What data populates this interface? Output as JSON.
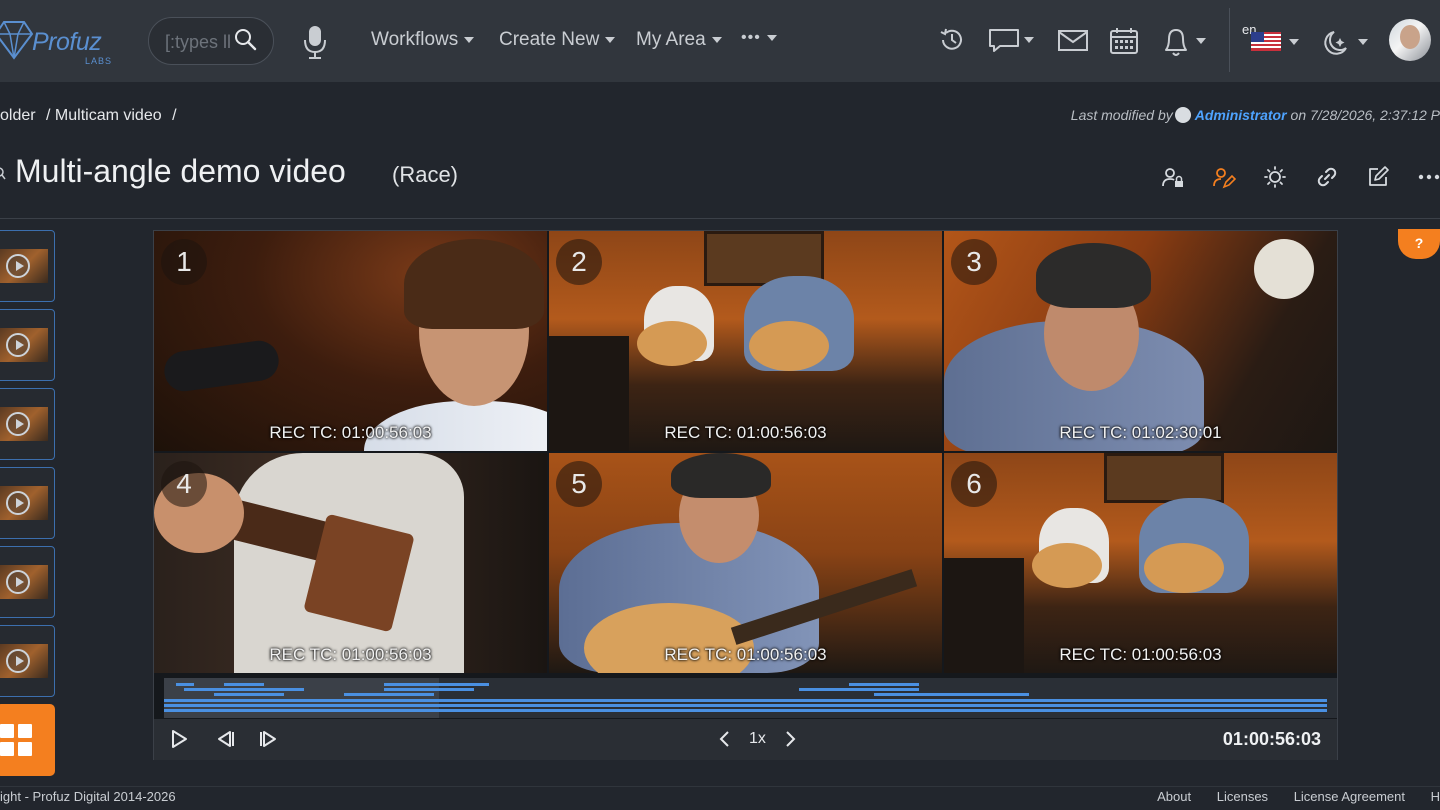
{
  "brand": {
    "name": "Profuz",
    "sub": "LABS"
  },
  "search": {
    "placeholder": "[:types ll"
  },
  "nav": [
    {
      "label": "Workflows"
    },
    {
      "label": "Create New"
    },
    {
      "label": "My Area"
    },
    {
      "label": "•••"
    }
  ],
  "language": {
    "code": "en"
  },
  "breadcrumb": {
    "items": [
      "older",
      "/ Multicam video",
      "/"
    ]
  },
  "last_modified": {
    "prefix": "Last modified by",
    "user": "Administrator",
    "suffix": "on 7/28/2026, 2:37:12 P"
  },
  "page": {
    "title": "Multi-angle demo video",
    "subtitle": "(Race)"
  },
  "cells": [
    {
      "num": "1",
      "tc": "REC TC: 01:00:56:03"
    },
    {
      "num": "2",
      "tc": "REC TC: 01:00:56:03"
    },
    {
      "num": "3",
      "tc": "REC TC: 01:02:30:01"
    },
    {
      "num": "4",
      "tc": "REC TC: 01:00:56:03"
    },
    {
      "num": "5",
      "tc": "REC TC: 01:00:56:03"
    },
    {
      "num": "6",
      "tc": "REC TC: 01:00:56:03"
    }
  ],
  "player": {
    "speed": "1x",
    "timecode": "01:00:56:03"
  },
  "help": {
    "label": "?"
  },
  "footer": {
    "copyright": "ight - Profuz Digital 2014-2026",
    "links": [
      "About",
      "Licenses",
      "License Agreement",
      "H"
    ]
  },
  "colors": {
    "accent": "#f47f1f",
    "link": "#4ea3ff",
    "timeline": "#4a90e2"
  }
}
